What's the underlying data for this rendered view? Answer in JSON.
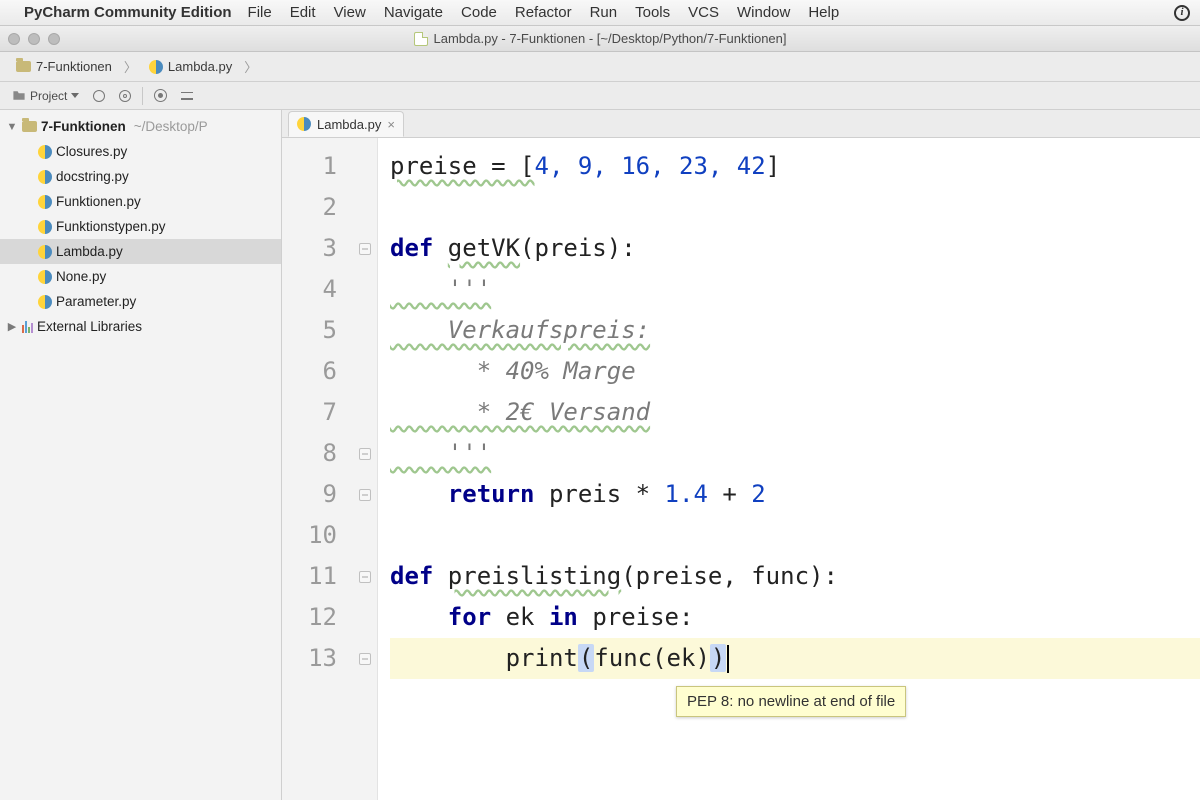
{
  "menubar": {
    "appname": "PyCharm Community Edition",
    "items": [
      "File",
      "Edit",
      "View",
      "Navigate",
      "Code",
      "Refactor",
      "Run",
      "Tools",
      "VCS",
      "Window",
      "Help"
    ]
  },
  "window": {
    "title": "Lambda.py - 7-Funktionen - [~/Desktop/Python/7-Funktionen]"
  },
  "breadcrumb": {
    "folder": "7-Funktionen",
    "file": "Lambda.py"
  },
  "toolbar": {
    "project_label": "Project"
  },
  "project_tree": {
    "root": "7-Funktionen",
    "root_path": "~/Desktop/P",
    "files": [
      "Closures.py",
      "docstring.py",
      "Funktionen.py",
      "Funktionstypen.py",
      "Lambda.py",
      "None.py",
      "Parameter.py"
    ],
    "selected": "Lambda.py",
    "external_libs": "External Libraries"
  },
  "tab": {
    "label": "Lambda.py"
  },
  "gutter": {
    "lines": [
      "1",
      "2",
      "3",
      "4",
      "5",
      "6",
      "7",
      "8",
      "9",
      "10",
      "11",
      "12",
      "13"
    ]
  },
  "code": {
    "l1_a": "preise = [",
    "l1_nums": "4, 9, 16, 23, 42",
    "l1_b": "]",
    "l3_def": "def ",
    "l3_fn": "getVK",
    "l3_sig": "(preis):",
    "l4": "    '''",
    "l5": "    Verkaufspreis:",
    "l6": "      * 40% Marge",
    "l7": "      * 2€ Versand",
    "l8": "    '''",
    "l9_ret": "    return ",
    "l9_expr_a": "preis * ",
    "l9_n1": "1.4",
    "l9_plus": " + ",
    "l9_n2": "2",
    "l11_def": "def ",
    "l11_fn": "preislisting",
    "l11_sig": "(preise, func):",
    "l12_for": "    for ",
    "l12_b": "ek ",
    "l12_in": "in ",
    "l12_c": "preise:",
    "l13_a": "        print",
    "l13_p1": "(",
    "l13_b": "func(ek)",
    "l13_p2": ")"
  },
  "tooltip": {
    "text": "PEP 8: no newline at end of file"
  }
}
